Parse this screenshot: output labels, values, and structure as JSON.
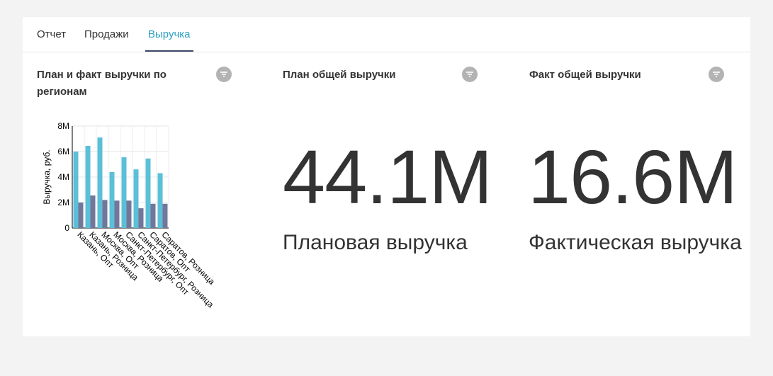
{
  "tabs": [
    {
      "label": "Отчет"
    },
    {
      "label": "Продажи"
    },
    {
      "label": "Выручка"
    }
  ],
  "active_tab": "Выручка",
  "widgets": {
    "chart_widget": {
      "title": "План и факт выручки по регионам"
    },
    "plan_widget": {
      "title": "План общей выручки",
      "value": "44.1M",
      "label": "Плановая выручка"
    },
    "fact_widget": {
      "title": "Факт общей выручки",
      "value": "16.6M",
      "label": "Фактическая выручка"
    }
  },
  "colors": {
    "accent": "#2a9fc1",
    "plan_bar": "#5bbfd8",
    "fact_bar": "#72779a",
    "filter_button": "#b3b3b3",
    "background": "#f3f3f3"
  },
  "icons": {
    "filter": "filter-icon"
  },
  "chart_data": {
    "type": "bar",
    "categories": [
      "Казань, Опт",
      "Казань, Розница",
      "Москва, Опт",
      "Москва, Розница",
      "Санкт-Петербург, Опт",
      "Санкт-Петербург, Розница",
      "Саратов, Опт",
      "Саратов, Розница"
    ],
    "series": [
      {
        "values": [
          6.0,
          6.45,
          7.1,
          4.4,
          5.55,
          4.6,
          5.45,
          4.3
        ]
      },
      {
        "values": [
          2.0,
          2.55,
          2.2,
          2.15,
          2.15,
          1.55,
          1.9,
          1.9
        ]
      }
    ],
    "ylabel": "Выручка, руб.",
    "yticks": [
      "0",
      "2M",
      "4M",
      "6M",
      "8M"
    ],
    "ylim": [
      0,
      8
    ],
    "grid": true
  }
}
